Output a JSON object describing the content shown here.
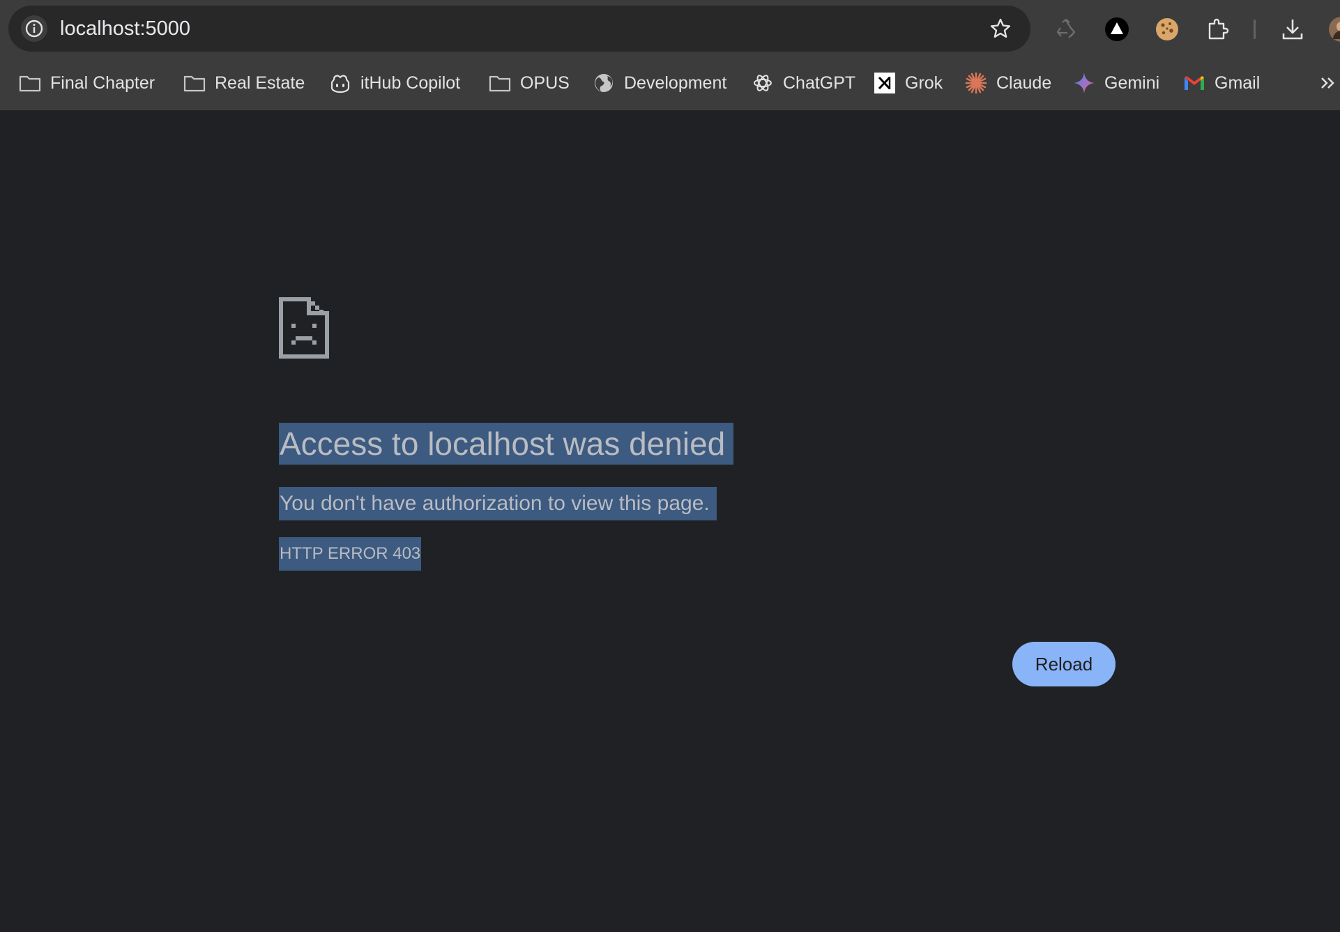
{
  "omnibox": {
    "url": "localhost:5000"
  },
  "toolbar_icons": [
    "site-info-icon",
    "bookmark-star-icon",
    "recycle-extension-icon",
    "triangle-extension-icon",
    "cookie-extension-icon",
    "extensions-puzzle-icon",
    "download-icon",
    "profile-avatar"
  ],
  "bookmarks": [
    {
      "label": "Final Chapter",
      "icon": "folder-icon"
    },
    {
      "label": "Real Estate",
      "icon": "folder-icon"
    },
    {
      "label": "itHub Copilot",
      "icon": "copilot-icon"
    },
    {
      "label": "OPUS",
      "icon": "folder-icon"
    },
    {
      "label": "Development",
      "icon": "globe-icon"
    },
    {
      "label": "ChatGPT",
      "icon": "chatgpt-icon"
    },
    {
      "label": "Grok",
      "icon": "grok-icon"
    },
    {
      "label": "Claude",
      "icon": "claude-icon"
    },
    {
      "label": "Gemini",
      "icon": "gemini-icon"
    },
    {
      "label": "Gmail",
      "icon": "gmail-icon"
    }
  ],
  "error_page": {
    "title": "Access to localhost was denied",
    "message": "You don't have authorization to view this page.",
    "code": "HTTP ERROR 403",
    "reload_label": "Reload"
  },
  "colors": {
    "page_background": "#202124",
    "toolbar_background": "#3c3c3c",
    "selection_highlight": "#3d5a80",
    "reload_button": "#8ab4f8",
    "claude_accent": "#d97757"
  }
}
